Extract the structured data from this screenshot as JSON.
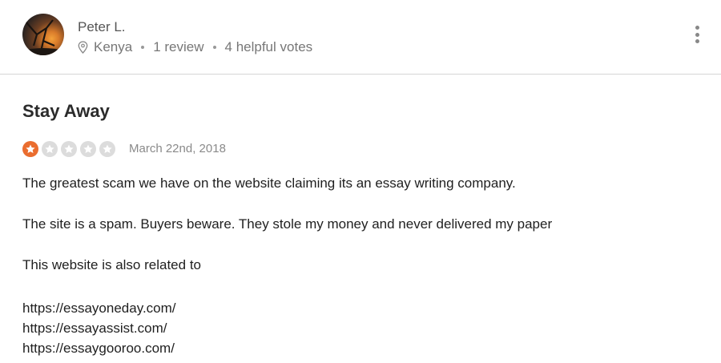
{
  "reviewer": {
    "name": "Peter L.",
    "location": "Kenya",
    "reviews": "1 review",
    "helpful_votes": "4 helpful votes"
  },
  "review": {
    "title": "Stay Away",
    "rating": 1,
    "max_rating": 5,
    "date": "March 22nd, 2018",
    "paragraphs": [
      "The greatest scam we have on the website claiming its an essay writing company.",
      "The site is a spam. Buyers beware. They stole my money and never delivered my paper",
      "This website is also related to"
    ],
    "links": [
      "https://essayoneday.com/",
      "https://essayassist.com/",
      "https://essaygooroo.com/"
    ]
  },
  "colors": {
    "star_filled": "#ea6d2f",
    "star_empty": "#dcdcdc"
  },
  "icons": {
    "location": "location-pin-icon",
    "menu": "more-vertical-icon",
    "star": "star-icon"
  }
}
